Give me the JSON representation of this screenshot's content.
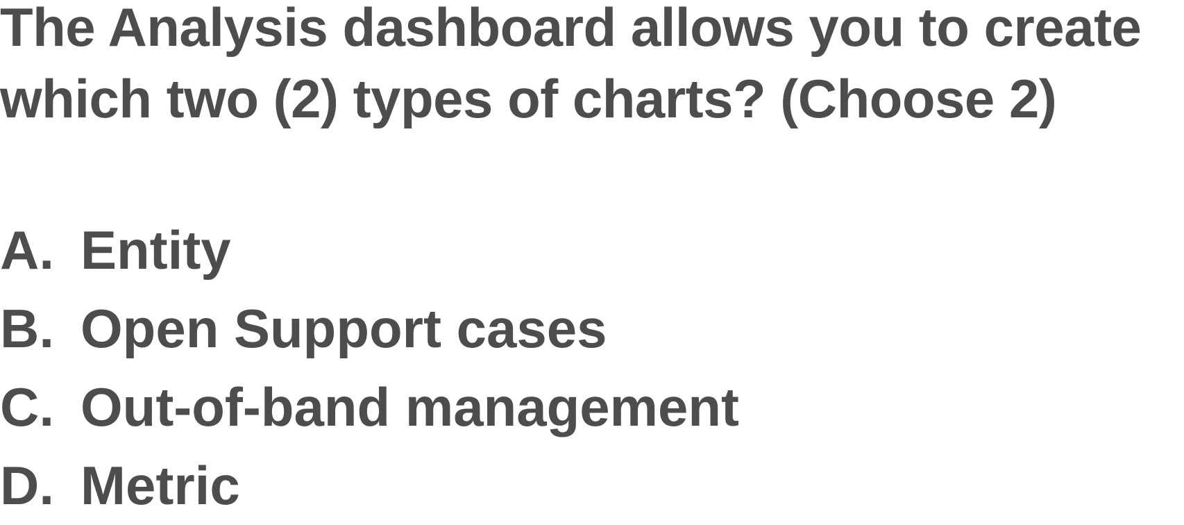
{
  "question": {
    "lines": [
      "The Analysis dashboard allows you to create",
      "which two (2) types of charts? (Choose 2)"
    ]
  },
  "options": [
    {
      "letter": "A.",
      "text": "Entity"
    },
    {
      "letter": "B.",
      "text": "Open Support cases"
    },
    {
      "letter": "C.",
      "text": "Out-of-band management"
    },
    {
      "letter": "D.",
      "text": "Metric"
    }
  ],
  "colors": {
    "text": "#4d4d4f",
    "background": "#ffffff"
  }
}
